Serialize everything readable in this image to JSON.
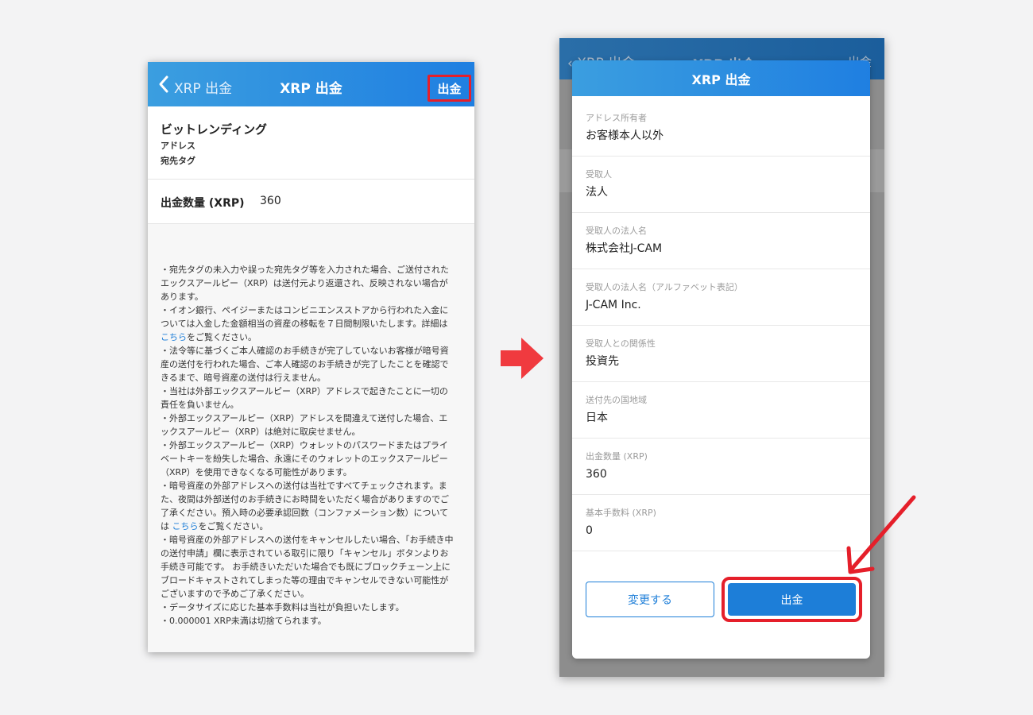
{
  "left_screen": {
    "nav": {
      "back_label": "XRP 出金",
      "title": "XRP 出金",
      "right_button": "出金"
    },
    "info": {
      "bank_name": "ビットレンディング",
      "address_label": "アドレス",
      "tag_label": "宛先タグ"
    },
    "amount": {
      "label": "出金数量 (XRP)",
      "value": "360"
    },
    "notes": [
      "・宛先タグの未入力や誤った宛先タグ等を入力された場合、ご送付されたエックスアールピー（XRP）は送付元より返還され、反映されない場合があります。",
      "・イオン銀行、ペイジーまたはコンビニエンスストアから行われた入金については入金した金額相当の資産の移転を７日間制限いたします。詳細は こちらをご覧ください。",
      "・法令等に基づくご本人確認のお手続きが完了していないお客様が暗号資産の送付を行われた場合、ご本人確認のお手続きが完了したことを確認できるまで、暗号資産の送付は行えません。",
      "・当社は外部エックスアールピー（XRP）アドレスで起きたことに一切の責任を負いません。",
      "・外部エックスアールピー（XRP）アドレスを間違えて送付した場合、エックスアールピー（XRP）は絶対に取戻せません。",
      "・外部エックスアールピー（XRP）ウォレットのパスワードまたはプライベートキーを紛失した場合、永遠にそのウォレットのエックスアールピー（XRP）を使用できなくなる可能性があります。",
      "・暗号資産の外部アドレスへの送付は当社ですべてチェックされます。また、夜間は外部送付のお手続きにお時間をいただく場合がありますのでご了承ください。預入時の必要承認回数（コンファメーション数）については こちらをご覧ください。",
      "・暗号資産の外部アドレスへの送付をキャンセルしたい場合、「お手続き中の送付申請」欄に表示されている取引に限り「キャンセル」ボタンよりお手続き可能です。 お手続きいただいた場合でも既にブロックチェーン上にブロードキャストされてしまった等の理由でキャンセルできない可能性がございますので予めご了承ください。",
      "・データサイズに応じた基本手数料は当社が負担いたします。",
      "・0.000001 XRP未満は切捨てられます。"
    ]
  },
  "right_screen": {
    "background_nav": {
      "back_label": "XRP 出金",
      "title": "XRP 出金",
      "right_button": "出金"
    },
    "modal": {
      "title": "XRP 出金",
      "fields": [
        {
          "label": "アドレス所有者",
          "value": "お客様本人以外"
        },
        {
          "label": "受取人",
          "value": "法人"
        },
        {
          "label": "受取人の法人名",
          "value": "株式会社J-CAM"
        },
        {
          "label": "受取人の法人名（アルファベット表記）",
          "value": "J-CAM Inc."
        },
        {
          "label": "受取人との関係性",
          "value": "投資先"
        },
        {
          "label": "送付先の国地域",
          "value": "日本"
        },
        {
          "label": "出金数量 (XRP)",
          "value": "360"
        },
        {
          "label": "基本手数料 (XRP)",
          "value": "0"
        }
      ],
      "change_button": "変更する",
      "withdraw_button": "出金"
    }
  },
  "colors": {
    "accent_blue": "#1d7ed8",
    "highlight_red": "#e51f2a"
  }
}
